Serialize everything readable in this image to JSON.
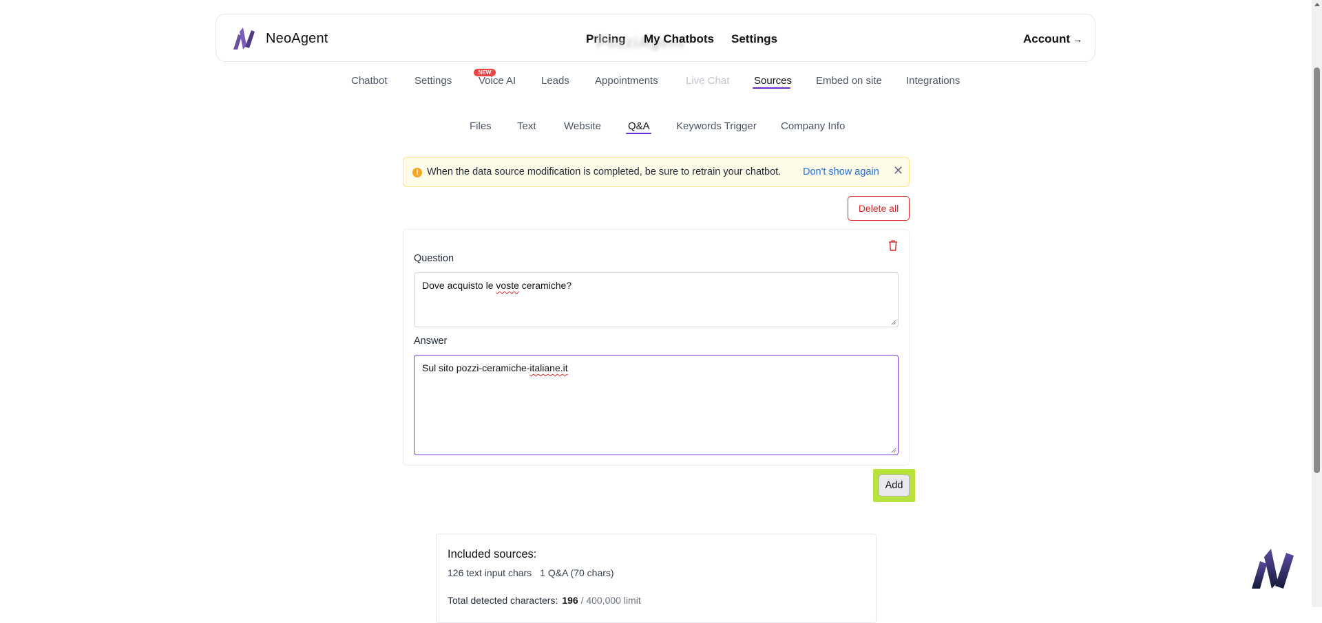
{
  "header": {
    "brand": "NeoAgent",
    "chatbot_name": "PozziAgent",
    "nav": {
      "pricing": "Pricing",
      "my_chatbots": "My Chatbots",
      "settings": "Settings"
    },
    "account": "Account",
    "account_arrow": "→"
  },
  "tabs": {
    "chatbot": "Chatbot",
    "settings": "Settings",
    "voice_ai": "Voice AI",
    "voice_ai_badge": "NEW",
    "leads": "Leads",
    "appointments": "Appointments",
    "live_chat": "Live Chat",
    "sources": "Sources",
    "embed": "Embed on site",
    "integrations": "Integrations",
    "active": "Sources"
  },
  "subtabs": {
    "files": "Files",
    "text": "Text",
    "website": "Website",
    "qa": "Q&A",
    "keywords": "Keywords Trigger",
    "company": "Company Info",
    "active": "Q&A"
  },
  "alert": {
    "icon": "!",
    "message": "When the data source modification is completed, be sure to retrain your chatbot.",
    "dont_show": "Don't show again",
    "close": "✕"
  },
  "delete_all": "Delete all",
  "qa": {
    "question_label": "Question",
    "question_pre": "Dove acquisto le ",
    "question_misspelled": "voste",
    "question_post": " ceramiche?",
    "answer_label": "Answer",
    "answer_pre": "Sul sito pozzi-ceramiche-",
    "answer_misspelled": "italiane.it"
  },
  "add_button": "Add",
  "summary": {
    "title": "Included sources:",
    "text_input": "126 text input chars",
    "qa_count": "1 Q&A (70 chars)",
    "total_label": "Total detected characters:",
    "total_value": "196",
    "limit": "/ 400,000 limit"
  },
  "colors": {
    "accent": "#6d28d9",
    "danger": "#dc2626",
    "link": "#1a73e8",
    "highlight": "#b7e33c",
    "alert_bg": "#fefbe8"
  },
  "icons": [
    "neoagent-logo-icon",
    "warning-icon",
    "close-icon",
    "trash-icon",
    "chat-widget-icon"
  ]
}
